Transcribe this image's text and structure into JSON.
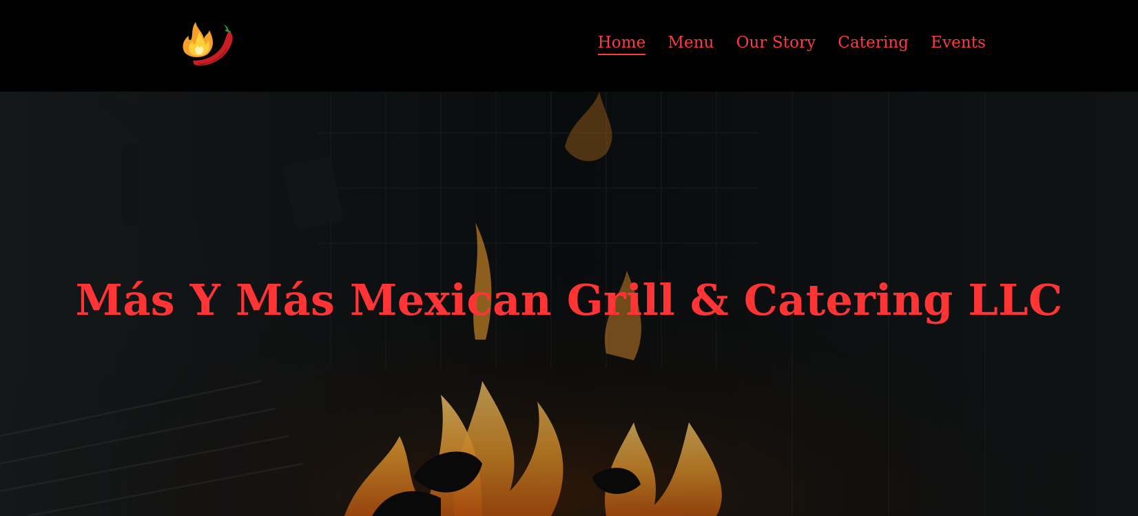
{
  "header": {
    "logo_icon": "flame-chili-pepper-icon",
    "nav": [
      {
        "label": "Home",
        "active": true
      },
      {
        "label": "Menu",
        "active": false
      },
      {
        "label": "Our Story",
        "active": false
      },
      {
        "label": "Catering",
        "active": false
      },
      {
        "label": "Events",
        "active": false
      }
    ]
  },
  "hero": {
    "title": "Más Y Más Mexican Grill & Catering LLC",
    "background": "kitchen-grill-flames-image"
  },
  "colors": {
    "accent": "#ff3b3b",
    "header_bg": "#000000",
    "hero_bg": "#0e1112",
    "flame_orange": "#f5a02a",
    "pepper_red": "#c81e24",
    "stem_green": "#2e9a3a"
  }
}
